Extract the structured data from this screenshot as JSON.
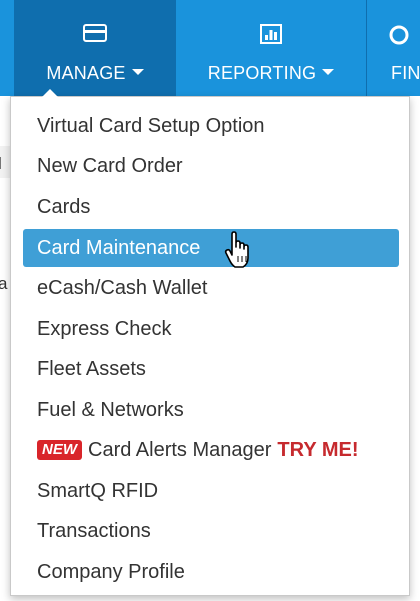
{
  "navbar": {
    "items": [
      {
        "label": "MANAGE",
        "icon": "credit-card-icon",
        "active": true
      },
      {
        "label": "REPORTING",
        "icon": "bar-chart-icon",
        "active": false
      },
      {
        "label": "FIN",
        "icon": "gear-icon",
        "active": false
      }
    ]
  },
  "left_fragments": [
    "l",
    "a"
  ],
  "menu": {
    "items": [
      {
        "label": "Virtual Card Setup Option"
      },
      {
        "label": "New Card Order"
      },
      {
        "label": "Cards"
      },
      {
        "label": "Card Maintenance",
        "active": true
      },
      {
        "label": "eCash/Cash Wallet"
      },
      {
        "label": "Express Check"
      },
      {
        "label": "Fleet Assets"
      },
      {
        "label": "Fuel & Networks"
      },
      {
        "label": "Card Alerts Manager",
        "badge": "NEW",
        "suffix": "TRY ME!"
      },
      {
        "label": "SmartQ RFID"
      },
      {
        "label": "Transactions"
      },
      {
        "label": "Company Profile"
      }
    ]
  },
  "colors": {
    "navbar": "#1a93dc",
    "navbar_active": "#0f6eae",
    "menu_active": "#3f9fd6",
    "badge_red": "#d9252a"
  }
}
